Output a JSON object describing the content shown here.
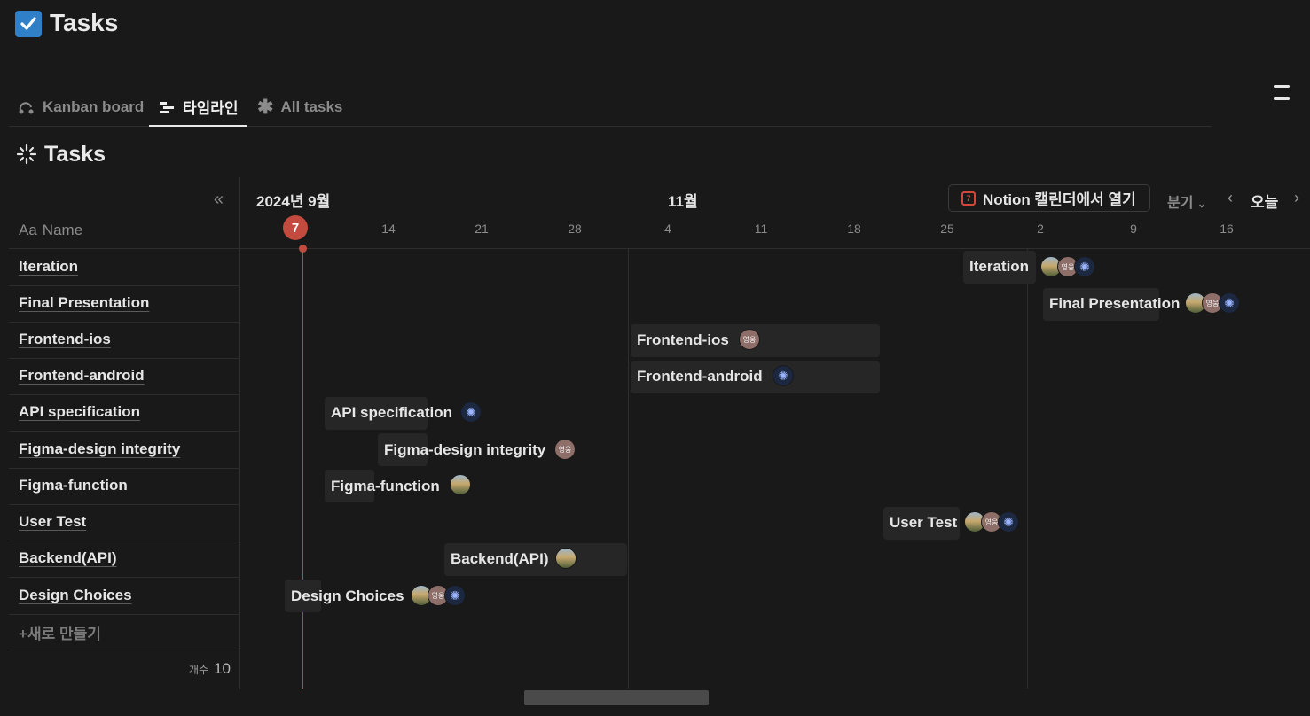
{
  "page": {
    "title": "Tasks",
    "icon": "checkbox-icon"
  },
  "tabs": [
    {
      "label": "Kanban board",
      "icon": "kanban-icon",
      "active": false
    },
    {
      "label": "타임라인",
      "icon": "timeline-icon",
      "active": true
    },
    {
      "label": "All tasks",
      "icon": "asterisk-icon",
      "active": false
    }
  ],
  "view": {
    "title": "Tasks",
    "icon": "loading-spinner-icon"
  },
  "table": {
    "name_header_icon": "Aa",
    "name_header": "Name",
    "rows": [
      "Iteration",
      "Final Presentation",
      "Frontend-ios",
      "Frontend-android",
      "API specification",
      "Figma-design integrity",
      "Figma-function",
      "User Test",
      "Backend(API)",
      "Design Choices"
    ],
    "new_label": "새로 만들기",
    "count_label": "개수",
    "count_value": "10"
  },
  "timeline": {
    "months": [
      "2024년 9월",
      "11월"
    ],
    "dates": [
      "7",
      "14",
      "21",
      "28",
      "4",
      "11",
      "18",
      "25",
      "2",
      "9",
      "16"
    ],
    "today": "7",
    "open_calendar_label": "Notion 캘린더에서 열기",
    "calendar_icon_text": "7",
    "period_label": "분기",
    "today_label": "오늘",
    "bars": [
      {
        "label": "Iteration",
        "assignees": [
          "photo",
          "영웅",
          "spark"
        ]
      },
      {
        "label": "Final Presentation",
        "assignees": [
          "photo",
          "영웅",
          "spark"
        ]
      },
      {
        "label": "Frontend-ios",
        "assignees": [
          "영웅"
        ]
      },
      {
        "label": "Frontend-android",
        "assignees": [
          "spark"
        ]
      },
      {
        "label": "API specification",
        "assignees": [
          "spark"
        ]
      },
      {
        "label": "Figma-design integrity",
        "assignees": [
          "영웅"
        ]
      },
      {
        "label": "Figma-function",
        "assignees": [
          "photo"
        ]
      },
      {
        "label": "User Test",
        "assignees": [
          "photo",
          "영웅",
          "spark"
        ]
      },
      {
        "label": "Backend(API)",
        "assignees": [
          "photo"
        ]
      },
      {
        "label": "Design Choices",
        "assignees": [
          "photo",
          "영웅",
          "spark"
        ]
      }
    ]
  },
  "colors": {
    "background": "#191919",
    "accent_red": "#c24a3f",
    "bar": "#262626"
  }
}
